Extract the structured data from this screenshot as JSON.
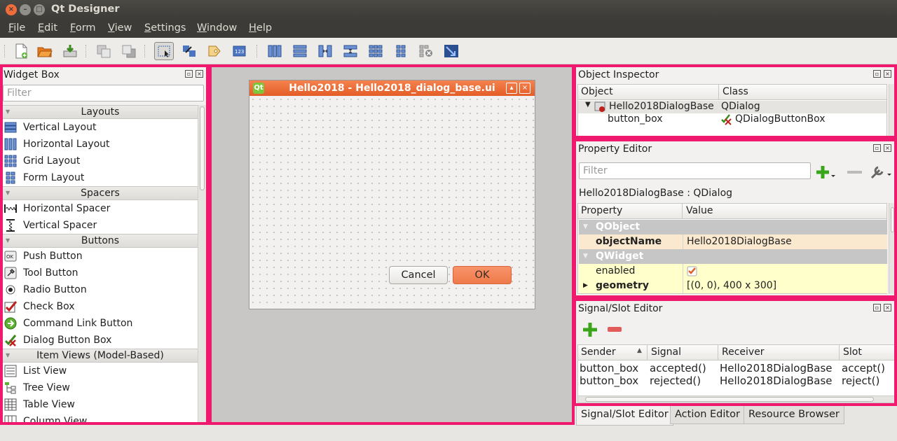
{
  "window": {
    "title": "Qt Designer",
    "buttons": {
      "close": "×",
      "minimize": "–",
      "maximize": "□"
    }
  },
  "menu": [
    "File",
    "Edit",
    "Form",
    "View",
    "Settings",
    "Window",
    "Help"
  ],
  "toolbar": {
    "icons": [
      "new-form-icon",
      "open-form-icon",
      "save-form-icon",
      "send-to-back-icon",
      "bring-to-front-icon",
      "edit-widgets-icon",
      "edit-signals-slots-icon",
      "edit-buddies-icon",
      "edit-tab-order-icon",
      "lay-out-horizontally-icon",
      "lay-out-vertically-icon",
      "lay-out-horizontal-splitter-icon",
      "lay-out-vertical-splitter-icon",
      "lay-out-grid-icon",
      "lay-out-form-icon",
      "break-layout-icon",
      "adjust-size-icon"
    ],
    "active": "edit-widgets-icon"
  },
  "widget_box": {
    "title": "Widget Box",
    "filter_placeholder": "Filter",
    "categories": [
      {
        "name": "Layouts",
        "items": [
          "Vertical Layout",
          "Horizontal Layout",
          "Grid Layout",
          "Form Layout"
        ]
      },
      {
        "name": "Spacers",
        "items": [
          "Horizontal Spacer",
          "Vertical Spacer"
        ]
      },
      {
        "name": "Buttons",
        "items": [
          "Push Button",
          "Tool Button",
          "Radio Button",
          "Check Box",
          "Command Link Button",
          "Dialog Button Box"
        ]
      },
      {
        "name": "Item Views (Model-Based)",
        "items": [
          "List View",
          "Tree View",
          "Table View",
          "Column View"
        ]
      }
    ]
  },
  "form": {
    "title": "Hello2018 - Hello2018_dialog_base.ui",
    "icon_text": "Qt",
    "cancel_label": "Cancel",
    "ok_label": "OK"
  },
  "object_inspector": {
    "title": "Object Inspector",
    "columns": [
      "Object",
      "Class"
    ],
    "rows": [
      {
        "object": "Hello2018DialogBase",
        "class": "QDialog"
      },
      {
        "object": "button_box",
        "class": "QDialogButtonBox"
      }
    ]
  },
  "property_editor": {
    "title": "Property Editor",
    "filter_placeholder": "Filter",
    "context": "Hello2018DialogBase : QDialog",
    "columns": [
      "Property",
      "Value"
    ],
    "groups": [
      {
        "name": "QObject",
        "props": [
          {
            "name": "objectName",
            "value": "Hello2018DialogBase"
          }
        ]
      },
      {
        "name": "QWidget",
        "props": [
          {
            "name": "enabled",
            "value": "checked"
          },
          {
            "name": "geometry",
            "value": "[(0, 0), 400 x 300]"
          }
        ]
      }
    ]
  },
  "signal_slot_editor": {
    "title": "Signal/Slot Editor",
    "columns": [
      "Sender",
      "Signal",
      "Receiver",
      "Slot"
    ],
    "rows": [
      {
        "sender": "button_box",
        "signal": "accepted()",
        "receiver": "Hello2018DialogBase",
        "slot": "accept()"
      },
      {
        "sender": "button_box",
        "signal": "rejected()",
        "receiver": "Hello2018DialogBase",
        "slot": "reject()"
      }
    ]
  },
  "bottom_tabs": [
    "Signal/Slot Editor",
    "Action Editor",
    "Resource Browser"
  ],
  "colors": {
    "highlight_frame": "#ef1a6d",
    "form_title": "#e45d27",
    "ok_button": "#ef7a4a"
  }
}
